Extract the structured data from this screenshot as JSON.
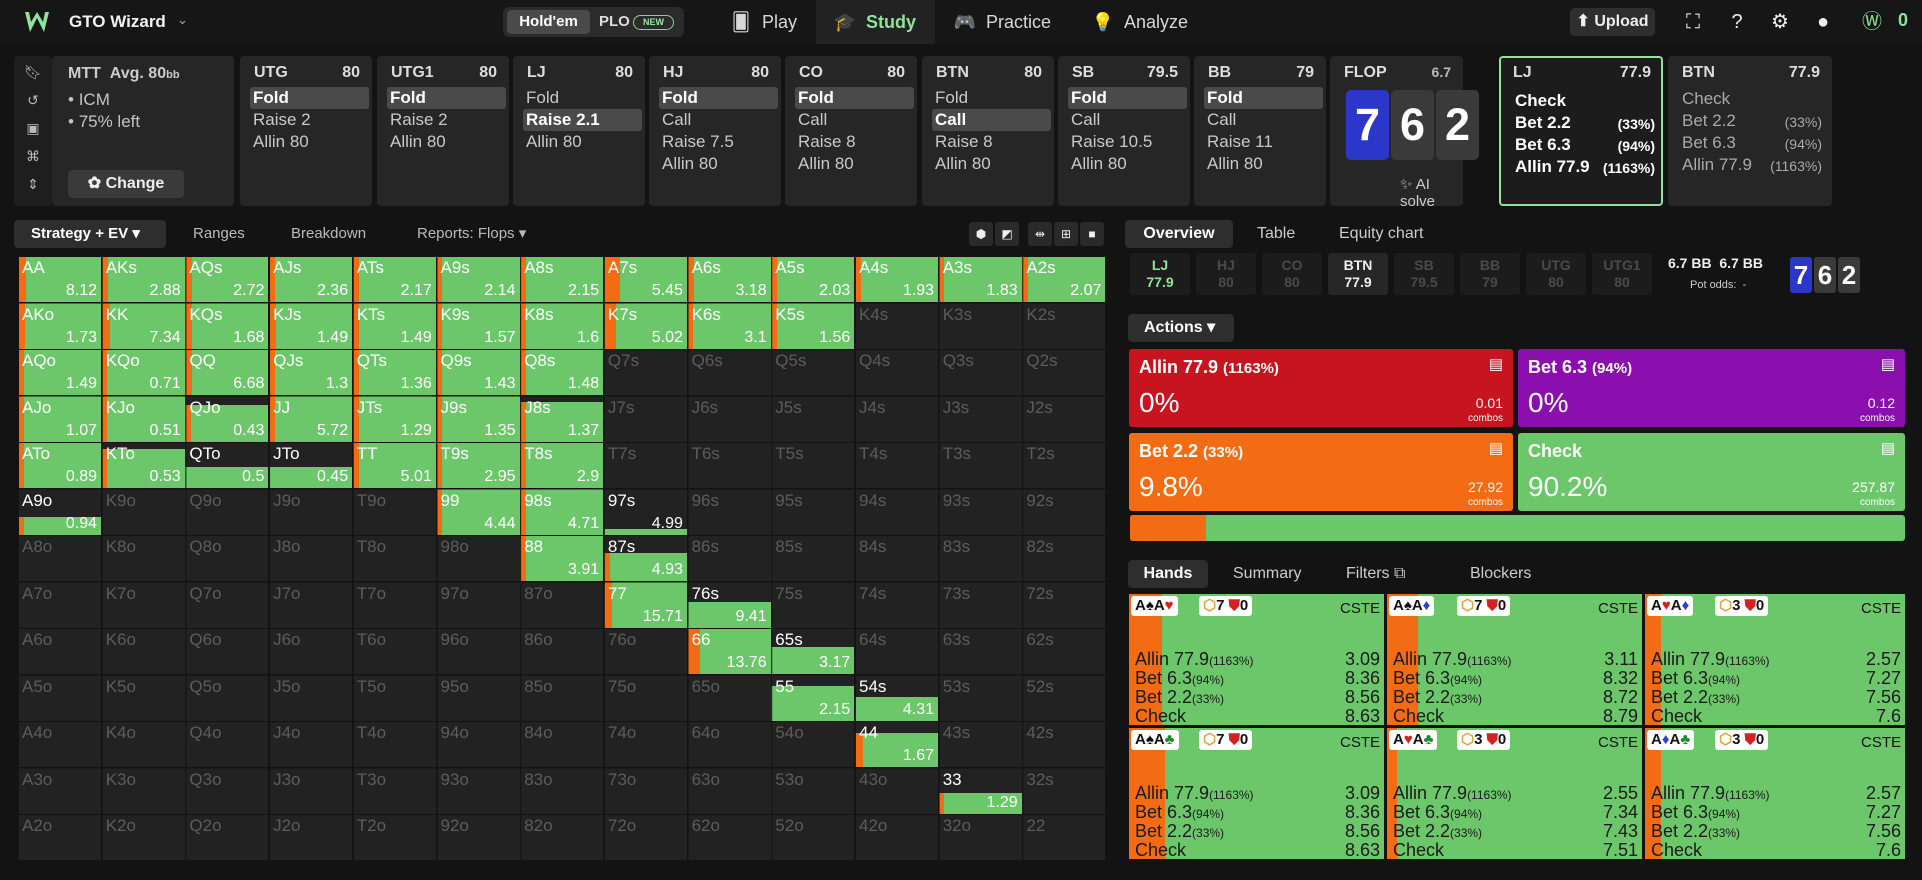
{
  "app": {
    "title": "GTO Wizard",
    "logo_letter": "W"
  },
  "nav": {
    "holdem": "Hold'em",
    "plo": "PLO",
    "new_badge": "NEW",
    "items": [
      "Play",
      "Study",
      "Practice",
      "Analyze"
    ],
    "active": "Study",
    "upload": "Upload",
    "credits": "0"
  },
  "mtt": {
    "title": "MTT",
    "avg": "Avg. 80",
    "avg_unit": "bb",
    "bullets": [
      "ICM",
      "75% left"
    ],
    "change_button": "Change"
  },
  "positions": [
    {
      "name": "UTG",
      "stack": "80",
      "actions": [
        {
          "label": "Fold",
          "selected": true
        },
        {
          "label": "Raise 2",
          "selected": false
        },
        {
          "label": "Allin 80",
          "selected": false
        }
      ]
    },
    {
      "name": "UTG1",
      "stack": "80",
      "actions": [
        {
          "label": "Fold",
          "selected": true
        },
        {
          "label": "Raise 2",
          "selected": false
        },
        {
          "label": "Allin 80",
          "selected": false
        }
      ]
    },
    {
      "name": "LJ",
      "stack": "80",
      "actions": [
        {
          "label": "Fold",
          "selected": false
        },
        {
          "label": "Raise 2.1",
          "selected": true
        },
        {
          "label": "Allin 80",
          "selected": false
        }
      ]
    },
    {
      "name": "HJ",
      "stack": "80",
      "actions": [
        {
          "label": "Fold",
          "selected": true
        },
        {
          "label": "Call",
          "selected": false
        },
        {
          "label": "Raise 7.5",
          "selected": false
        },
        {
          "label": "Allin 80",
          "selected": false
        }
      ]
    },
    {
      "name": "CO",
      "stack": "80",
      "actions": [
        {
          "label": "Fold",
          "selected": true
        },
        {
          "label": "Call",
          "selected": false
        },
        {
          "label": "Raise 8",
          "selected": false
        },
        {
          "label": "Allin 80",
          "selected": false
        }
      ]
    },
    {
      "name": "BTN",
      "stack": "80",
      "actions": [
        {
          "label": "Fold",
          "selected": false
        },
        {
          "label": "Call",
          "selected": true
        },
        {
          "label": "Raise 8",
          "selected": false
        },
        {
          "label": "Allin 80",
          "selected": false
        }
      ]
    },
    {
      "name": "SB",
      "stack": "79.5",
      "actions": [
        {
          "label": "Fold",
          "selected": true
        },
        {
          "label": "Call",
          "selected": false
        },
        {
          "label": "Raise 10.5",
          "selected": false
        },
        {
          "label": "Allin 80",
          "selected": false
        }
      ]
    },
    {
      "name": "BB",
      "stack": "79",
      "actions": [
        {
          "label": "Fold",
          "selected": true
        },
        {
          "label": "Call",
          "selected": false
        },
        {
          "label": "Raise 11",
          "selected": false
        },
        {
          "label": "Allin 80",
          "selected": false
        }
      ]
    }
  ],
  "flop": {
    "title": "FLOP",
    "pot": "6.7",
    "cards": [
      "7",
      "6",
      "2"
    ],
    "card_colors": [
      "#2a37c9",
      "#3a3a3a",
      "#3a3a3a"
    ],
    "ai_solve": "AI solve"
  },
  "lj_panel": {
    "name": "LJ",
    "stack": "77.9",
    "actions": [
      {
        "label": "Check",
        "pct": ""
      },
      {
        "label": "Bet 2.2",
        "pct": "(33%)"
      },
      {
        "label": "Bet 6.3",
        "pct": "(94%)"
      },
      {
        "label": "Allin 77.9",
        "pct": "(1163%)"
      }
    ]
  },
  "btn_panel": {
    "name": "BTN",
    "stack": "77.9",
    "actions": [
      {
        "label": "Check",
        "pct": ""
      },
      {
        "label": "Bet 2.2",
        "pct": "(33%)"
      },
      {
        "label": "Bet 6.3",
        "pct": "(94%)"
      },
      {
        "label": "Allin 77.9",
        "pct": "(1163%)"
      }
    ]
  },
  "strategy_tabs": {
    "active": "Strategy + EV",
    "others": [
      "Ranges",
      "Breakdown",
      "Reports: Flops"
    ]
  },
  "colors": {
    "green": "#6cc76b",
    "orange": "#f36b12",
    "red": "#c8141e",
    "purple": "#8a0fae",
    "empty": "#222222"
  },
  "grid": {
    "ranks": [
      "A",
      "K",
      "Q",
      "J",
      "T",
      "9",
      "8",
      "7",
      "6",
      "5",
      "4",
      "3",
      "2"
    ],
    "cells": {
      "AA": [
        0.1,
        "8.12"
      ],
      "AKs": [
        0.08,
        "2.88"
      ],
      "AQs": [
        0.08,
        "2.72"
      ],
      "AJs": [
        0.07,
        "2.36"
      ],
      "ATs": [
        0.07,
        "2.17"
      ],
      "A9s": [
        0.07,
        "2.14"
      ],
      "A8s": [
        0.07,
        "2.15"
      ],
      "A7s": [
        0.2,
        "5.45"
      ],
      "A6s": [
        0.08,
        "3.18"
      ],
      "A5s": [
        0.07,
        "2.03"
      ],
      "A4s": [
        0.07,
        "1.93"
      ],
      "A3s": [
        0.07,
        "1.83"
      ],
      "A2s": [
        0.07,
        "2.07"
      ],
      "AKo": [
        0.08,
        "1.73"
      ],
      "KK": [
        0.1,
        "7.34"
      ],
      "KQs": [
        0.08,
        "1.68"
      ],
      "KJs": [
        0.08,
        "1.49"
      ],
      "KTs": [
        0.08,
        "1.49"
      ],
      "K9s": [
        0.07,
        "1.57"
      ],
      "K8s": [
        0.07,
        "1.6"
      ],
      "K7s": [
        0.15,
        "5.02"
      ],
      "K6s": [
        0.07,
        "3.1"
      ],
      "K5s": [
        0.07,
        "1.56"
      ],
      "AQo": [
        0.07,
        "1.49"
      ],
      "KQo": [
        0.07,
        "0.71"
      ],
      "QQ": [
        0.08,
        "6.68"
      ],
      "QJs": [
        0.07,
        "1.3"
      ],
      "QTs": [
        0.07,
        "1.36"
      ],
      "Q9s": [
        0.07,
        "1.43"
      ],
      "Q8s": [
        0.07,
        "1.48"
      ],
      "AJo": [
        0.07,
        "1.07"
      ],
      "KJo": [
        0.07,
        "0.51"
      ],
      "QJo": [
        0.07,
        "0.43",
        0.8
      ],
      "JJ": [
        0.07,
        "5.72"
      ],
      "JTs": [
        0.07,
        "1.29"
      ],
      "J9s": [
        0.07,
        "1.35"
      ],
      "J8s": [
        0.07,
        "1.37",
        0.85
      ],
      "ATo": [
        0.07,
        "0.89"
      ],
      "KTo": [
        0.07,
        "0.53",
        0.85
      ],
      "QTo": [
        0.0,
        "0.5",
        0.45
      ],
      "JTo": [
        0.0,
        "0.45",
        0.45
      ],
      "TT": [
        0.07,
        "5.01"
      ],
      "T9s": [
        0.07,
        "2.95"
      ],
      "T8s": [
        0.07,
        "2.9"
      ],
      "A9o": [
        0.07,
        "0.94",
        0.38
      ],
      "99": [
        0.07,
        "4.44"
      ],
      "98s": [
        0.07,
        "4.71"
      ],
      "97s": [
        0.0,
        "4.99",
        0.12
      ],
      "88": [
        0.07,
        "3.91"
      ],
      "87s": [
        0.07,
        "4.93",
        0.6
      ],
      "77": [
        0.1,
        "15.71"
      ],
      "76s": [
        0.0,
        "9.41",
        0.55
      ],
      "66": [
        0.15,
        "13.76"
      ],
      "65s": [
        0.0,
        "3.17",
        0.58
      ],
      "55": [
        0.0,
        "2.15",
        0.75
      ],
      "54s": [
        0.0,
        "4.31",
        0.52
      ],
      "44": [
        0.1,
        "1.67",
        0.75
      ],
      "33": [
        0.07,
        "1.29",
        0.45
      ]
    }
  },
  "right_tabs": {
    "active": "Overview",
    "others": [
      "Table",
      "Equity chart"
    ]
  },
  "position_chips": [
    {
      "name": "LJ",
      "stack": "77.9",
      "state": "active"
    },
    {
      "name": "HJ",
      "stack": "80",
      "state": "dim"
    },
    {
      "name": "CO",
      "stack": "80",
      "state": "dim"
    },
    {
      "name": "BTN",
      "stack": "77.9",
      "state": "live"
    },
    {
      "name": "SB",
      "stack": "79.5",
      "state": "dim"
    },
    {
      "name": "BB",
      "stack": "79",
      "state": "dim"
    },
    {
      "name": "UTG",
      "stack": "80",
      "state": "dim"
    },
    {
      "name": "UTG1",
      "stack": "80",
      "state": "dim"
    }
  ],
  "pot_info": {
    "pot1": "6.7 BB",
    "pot2": "6.7 BB",
    "odds_label": "Pot odds:",
    "odds_value": "-"
  },
  "actions_dropdown": "Actions",
  "action_boxes": [
    {
      "label": "Allin 77.9",
      "size": "(1163%)",
      "pct": "0%",
      "combos": "0.01",
      "unit": "combos",
      "color": "#c8141e"
    },
    {
      "label": "Bet 6.3",
      "size": "(94%)",
      "pct": "0%",
      "combos": "0.12",
      "unit": "combos",
      "color": "#8a0fae"
    },
    {
      "label": "Bet 2.2",
      "size": "(33%)",
      "pct": "9.8%",
      "combos": "27.92",
      "unit": "combos",
      "color": "#f36b12"
    },
    {
      "label": "Check",
      "size": "",
      "pct": "90.2%",
      "combos": "257.87",
      "unit": "combos",
      "color": "#6cc76b"
    }
  ],
  "freq_bar": {
    "bet_fraction": 0.098
  },
  "hand_tabs": {
    "active": "Hands",
    "others": [
      "Summary",
      "Filters",
      "Blockers"
    ]
  },
  "hands": [
    {
      "cards": [
        [
          "A",
          "♠",
          "blk"
        ],
        [
          "A",
          "♥",
          "red"
        ]
      ],
      "blocker_a": "7",
      "blocker_b": "0",
      "tag": "CSTE",
      "bar": 0.13,
      "rows": [
        [
          "Allin 77.9",
          "(1163%)",
          "3.09"
        ],
        [
          "Bet 6.3",
          "(94%)",
          "8.36"
        ],
        [
          "Bet 2.2",
          "(33%)",
          "8.56"
        ],
        [
          "Check",
          "",
          "8.63"
        ]
      ]
    },
    {
      "cards": [
        [
          "A",
          "♠",
          "blk"
        ],
        [
          "A",
          "♦",
          "blue"
        ]
      ],
      "blocker_a": "7",
      "blocker_b": "0",
      "tag": "CSTE",
      "bar": 0.12,
      "rows": [
        [
          "Allin 77.9",
          "(1163%)",
          "3.11"
        ],
        [
          "Bet 6.3",
          "(94%)",
          "8.32"
        ],
        [
          "Bet 2.2",
          "(33%)",
          "8.72"
        ],
        [
          "Check",
          "",
          "8.79"
        ]
      ]
    },
    {
      "cards": [
        [
          "A",
          "♥",
          "red"
        ],
        [
          "A",
          "♦",
          "blue"
        ]
      ],
      "blocker_a": "3",
      "blocker_b": "0",
      "tag": "CSTE",
      "bar": 0.06,
      "rows": [
        [
          "Allin 77.9",
          "(1163%)",
          "2.57"
        ],
        [
          "Bet 6.3",
          "(94%)",
          "7.27"
        ],
        [
          "Bet 2.2",
          "(33%)",
          "7.56"
        ],
        [
          "Check",
          "",
          "7.6"
        ]
      ]
    },
    {
      "cards": [
        [
          "A",
          "♠",
          "blk"
        ],
        [
          "A",
          "♣",
          "green"
        ]
      ],
      "blocker_a": "7",
      "blocker_b": "0",
      "tag": "CSTE",
      "bar": 0.14,
      "rows": [
        [
          "Allin 77.9",
          "(1163%)",
          "3.09"
        ],
        [
          "Bet 6.3",
          "(94%)",
          "8.36"
        ],
        [
          "Bet 2.2",
          "(33%)",
          "8.56"
        ],
        [
          "Check",
          "",
          "8.63"
        ]
      ]
    },
    {
      "cards": [
        [
          "A",
          "♥",
          "red"
        ],
        [
          "A",
          "♣",
          "green"
        ]
      ],
      "blocker_a": "3",
      "blocker_b": "0",
      "tag": "CSTE",
      "bar": 0.04,
      "rows": [
        [
          "Allin 77.9",
          "(1163%)",
          "2.55"
        ],
        [
          "Bet 6.3",
          "(94%)",
          "7.34"
        ],
        [
          "Bet 2.2",
          "(33%)",
          "7.43"
        ],
        [
          "Check",
          "",
          "7.51"
        ]
      ]
    },
    {
      "cards": [
        [
          "A",
          "♦",
          "blue"
        ],
        [
          "A",
          "♣",
          "green"
        ]
      ],
      "blocker_a": "3",
      "blocker_b": "0",
      "tag": "CSTE",
      "bar": 0.06,
      "rows": [
        [
          "Allin 77.9",
          "(1163%)",
          "2.57"
        ],
        [
          "Bet 6.3",
          "(94%)",
          "7.27"
        ],
        [
          "Bet 2.2",
          "(33%)",
          "7.56"
        ],
        [
          "Check",
          "",
          "7.6"
        ]
      ]
    }
  ]
}
